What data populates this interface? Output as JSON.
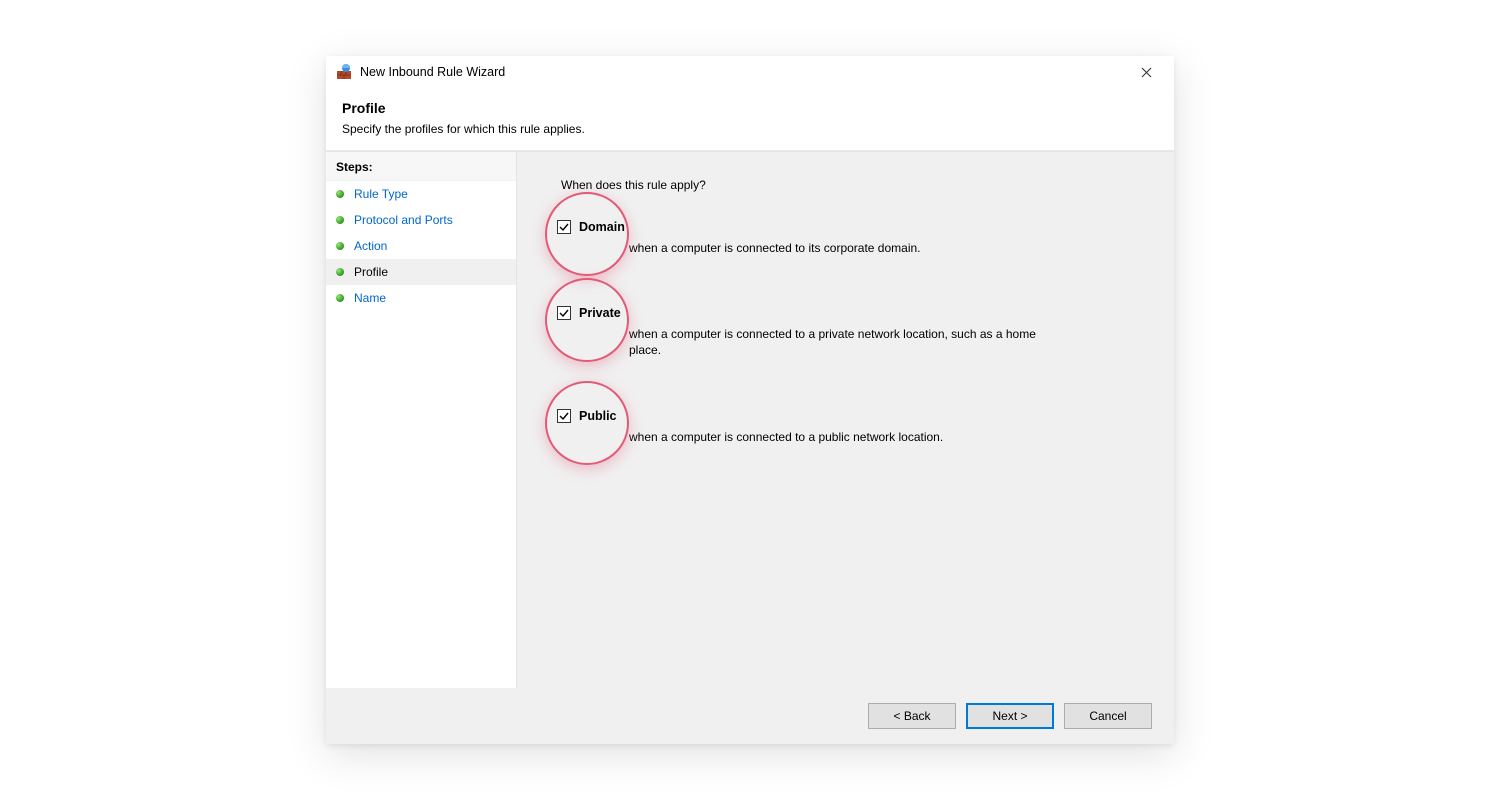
{
  "window": {
    "title": "New Inbound Rule Wizard"
  },
  "header": {
    "title": "Profile",
    "subtitle": "Specify the profiles for which this rule applies."
  },
  "sidebar": {
    "heading": "Steps:",
    "items": [
      {
        "label": "Rule Type"
      },
      {
        "label": "Protocol and Ports"
      },
      {
        "label": "Action"
      },
      {
        "label": "Profile"
      },
      {
        "label": "Name"
      }
    ],
    "current_index": 3
  },
  "content": {
    "question": "When does this rule apply?",
    "profiles": [
      {
        "key": "domain",
        "label": "Domain",
        "checked": true,
        "highlighted": true,
        "desc_visible": "when a computer is connected to its corporate domain."
      },
      {
        "key": "private",
        "label": "Private",
        "checked": true,
        "highlighted": true,
        "desc_visible": "when a computer is connected to a private network location, such as a home",
        "desc_visible_line2": "place."
      },
      {
        "key": "public",
        "label": "Public",
        "checked": true,
        "highlighted": true,
        "desc_visible": "when a computer is connected to a public network location."
      }
    ]
  },
  "footer": {
    "back": "< Back",
    "next": "Next >",
    "cancel": "Cancel"
  },
  "annotation": {
    "ring_color": "#e25a77"
  }
}
